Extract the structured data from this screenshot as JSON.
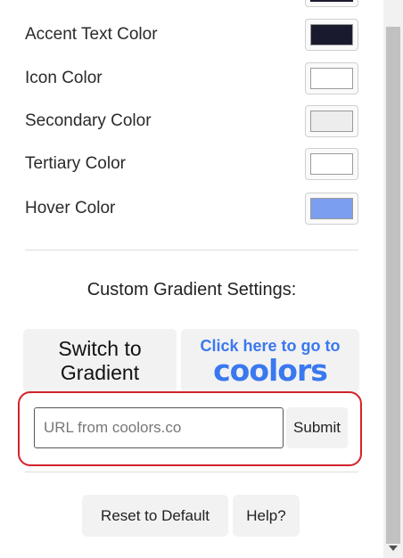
{
  "color_settings": [
    {
      "label": "Accent Text Color",
      "color": "#1a1a2e"
    },
    {
      "label": "Icon Color",
      "color": "#ffffff"
    },
    {
      "label": "Secondary Color",
      "color": "#ededed"
    },
    {
      "label": "Tertiary Color",
      "color": "#ffffff"
    },
    {
      "label": "Hover Color",
      "color": "#7b9ef0"
    }
  ],
  "top_partial_swatch_color": "#1a1a2e",
  "gradient": {
    "section_title": "Custom Gradient Settings:",
    "switch_button_label": "Switch to Gradient",
    "coolors_button": {
      "top_text": "Click here to go to",
      "logo_text": "coolors"
    },
    "url_input": {
      "placeholder": "URL from coolors.co",
      "value": ""
    },
    "submit_label": "Submit"
  },
  "footer": {
    "reset_label": "Reset to Default",
    "help_label": "Help?"
  },
  "colors": {
    "highlight_border": "#d2232a",
    "coolors_blue": "#3a78ef"
  }
}
